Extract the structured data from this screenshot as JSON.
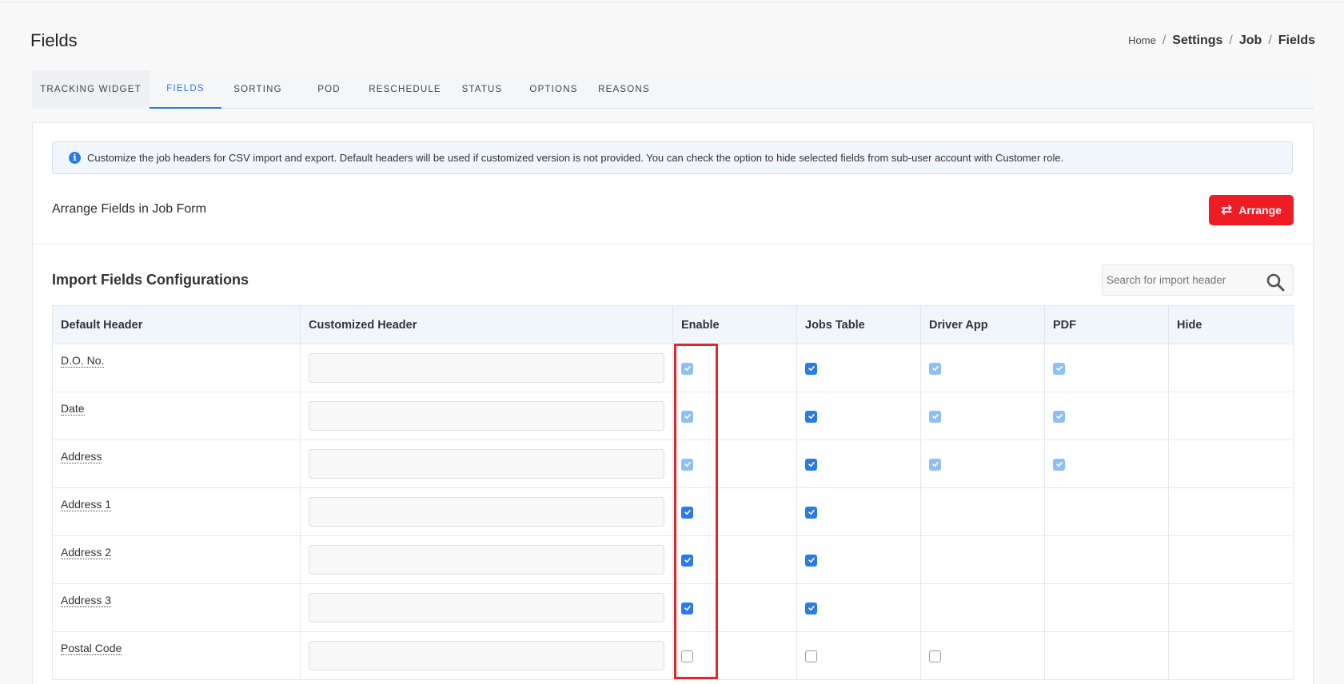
{
  "page": {
    "title": "Fields"
  },
  "breadcrumb": {
    "home": "Home",
    "items": [
      "Settings",
      "Job",
      "Fields"
    ]
  },
  "tabs": [
    "TRACKING WIDGET",
    "FIELDS",
    "SORTING",
    "POD",
    "RESCHEDULE",
    "STATUS",
    "OPTIONS",
    "REASONS"
  ],
  "active_tab": "FIELDS",
  "info": {
    "text": "Customize the job headers for CSV import and export. Default headers will be used if customized version is not provided. You can check the option to hide selected fields from sub-user account with Customer role."
  },
  "arrange": {
    "label": "Arrange Fields in Job Form",
    "button": "Arrange"
  },
  "import": {
    "title": "Import Fields Configurations",
    "search_placeholder": "Search for import header",
    "columns": [
      "Default Header",
      "Customized Header",
      "Enable",
      "Jobs Table",
      "Driver App",
      "PDF",
      "Hide"
    ],
    "rows": [
      {
        "name": "D.O. No.",
        "enable": "disabled",
        "jobs": "on",
        "driver": "disabled",
        "pdf": "disabled",
        "hide": "none"
      },
      {
        "name": "Date",
        "enable": "disabled",
        "jobs": "on",
        "driver": "disabled",
        "pdf": "disabled",
        "hide": "none"
      },
      {
        "name": "Address",
        "enable": "disabled",
        "jobs": "on",
        "driver": "disabled",
        "pdf": "disabled",
        "hide": "none"
      },
      {
        "name": "Address 1",
        "enable": "on",
        "jobs": "on",
        "driver": "none",
        "pdf": "none",
        "hide": "none"
      },
      {
        "name": "Address 2",
        "enable": "on",
        "jobs": "on",
        "driver": "none",
        "pdf": "none",
        "hide": "none"
      },
      {
        "name": "Address 3",
        "enable": "on",
        "jobs": "on",
        "driver": "none",
        "pdf": "none",
        "hide": "none"
      },
      {
        "name": "Postal Code",
        "enable": "off",
        "jobs": "off",
        "driver": "off",
        "pdf": "none",
        "hide": "none"
      }
    ]
  },
  "colors": {
    "primary": "#2a7be4",
    "danger": "#ee1c25",
    "highlight": "#e4262a"
  }
}
